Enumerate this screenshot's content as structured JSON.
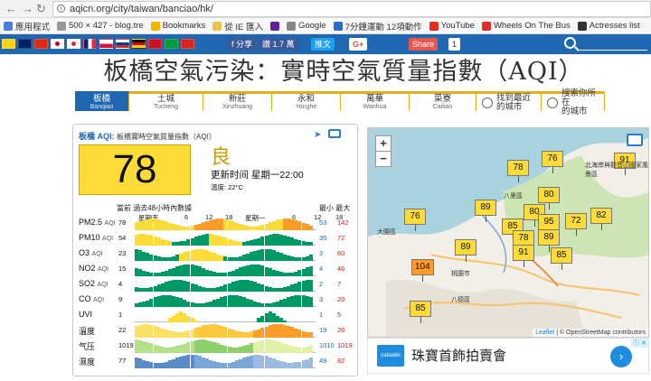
{
  "browser": {
    "url": "aqicn.org/city/taiwan/banciao/hk/",
    "bookmarks": [
      {
        "label": "應用程式",
        "icon": "apps-icon",
        "color": "#4a7fd6"
      },
      {
        "label": "500 × 427 - blog.tre",
        "icon": "page-icon",
        "color": "#999999"
      },
      {
        "label": "Bookmarks",
        "icon": "star-icon",
        "color": "#f4b400"
      },
      {
        "label": "從 IE 匯入",
        "icon": "folder-icon",
        "color": "#e8c64a"
      },
      {
        "label": "",
        "icon": "yahoo-icon",
        "color": "#5f1f9e"
      },
      {
        "label": "Google",
        "icon": "google-icon",
        "color": "#888888"
      },
      {
        "label": "7分鐘運動 12項動作",
        "icon": "page-icon",
        "color": "#2b6cc4"
      },
      {
        "label": "YouTube",
        "icon": "youtube-icon",
        "color": "#e52d27"
      },
      {
        "label": "Wheels On The Bus",
        "icon": "youtube-icon",
        "color": "#e52d27"
      },
      {
        "label": "Actresses list",
        "icon": "page-icon",
        "color": "#333333"
      }
    ]
  },
  "social": {
    "fb_share": "f 分享",
    "like": "讚 1.7 萬",
    "tweet": "推文",
    "gplus": "G+",
    "share": "Share",
    "share_count": "1"
  },
  "page": {
    "title": "板橋空氣污染：實時空氣質量指數（AQI）"
  },
  "tabs": [
    {
      "name": "板橋",
      "sub": "Banqiao",
      "active": true,
      "w": 60
    },
    {
      "name": "土城",
      "sub": "Tucheng",
      "active": false,
      "w": 82
    },
    {
      "name": "新莊",
      "sub": "Xinzhuang",
      "active": false,
      "w": 76
    },
    {
      "name": "永和",
      "sub": "Yonghe",
      "active": false,
      "w": 76
    },
    {
      "name": "萬華",
      "sub": "Wanhua",
      "active": false,
      "w": 76
    },
    {
      "name": "菜寮",
      "sub": "Cailiao",
      "active": false,
      "w": 74
    }
  ],
  "tabs_extra": {
    "nearest": [
      "找到最近",
      "的城市"
    ],
    "search": [
      "搜索你所在",
      "的城市"
    ]
  },
  "panel": {
    "city": "板橋",
    "aqi_label": "AQI:",
    "station": "板橋實時空氣質量指數（AQI）",
    "aqi": "78",
    "level": "良",
    "update": "更新时间 星期一22:00",
    "temperature": "溫度: 22°C",
    "graph_title": "當前 過去48小時內數據",
    "min_label": "最小",
    "max_label": "最大",
    "hour_labels": [
      "星期天",
      "6",
      "12",
      "18",
      "星期一",
      "6",
      "12",
      "18"
    ],
    "rows": [
      {
        "name": "PM2.5",
        "unit": "AQI",
        "current": "78",
        "min": "53",
        "max": "142"
      },
      {
        "name": "PM10",
        "unit": "AQI",
        "current": "54",
        "min": "35",
        "max": "72"
      },
      {
        "name": "O3",
        "unit": "AQI",
        "current": "23",
        "min": "3",
        "max": "60"
      },
      {
        "name": "NO2",
        "unit": "AQI",
        "current": "15",
        "min": "4",
        "max": "46"
      },
      {
        "name": "SO2",
        "unit": "AQI",
        "current": "4",
        "min": "2",
        "max": "7"
      },
      {
        "name": "CO",
        "unit": "AQI",
        "current": "9",
        "min": "3",
        "max": "20"
      },
      {
        "name": "UVI",
        "unit": "",
        "current": "1",
        "min": "1",
        "max": "5"
      },
      {
        "name": "溫度",
        "unit": "",
        "current": "22",
        "min": "19",
        "max": "26"
      },
      {
        "name": "气压",
        "unit": "",
        "current": "1019",
        "min": "1010",
        "max": "1019"
      },
      {
        "name": "濕度",
        "unit": "",
        "current": "77",
        "min": "49",
        "max": "82"
      }
    ]
  },
  "map": {
    "zoom_in": "+",
    "zoom_out": "−",
    "markers": [
      "78",
      "76",
      "91",
      "80",
      "76",
      "89",
      "85",
      "80",
      "95",
      "82",
      "72",
      "78",
      "89",
      "89",
      "91",
      "85",
      "104",
      "85"
    ],
    "places": [
      "北海岸與觀音山國家風景區",
      "桃園市",
      "八德區",
      "大園區",
      "八里區"
    ],
    "attribution_leaflet": "Leaflet",
    "attribution_rest": " | © OpenStreetMap contributors"
  },
  "ad": {
    "logo": "catawiki",
    "text": "珠寶首飾拍賣會",
    "arrow": "›",
    "badge": "ⓘ ✕"
  }
}
